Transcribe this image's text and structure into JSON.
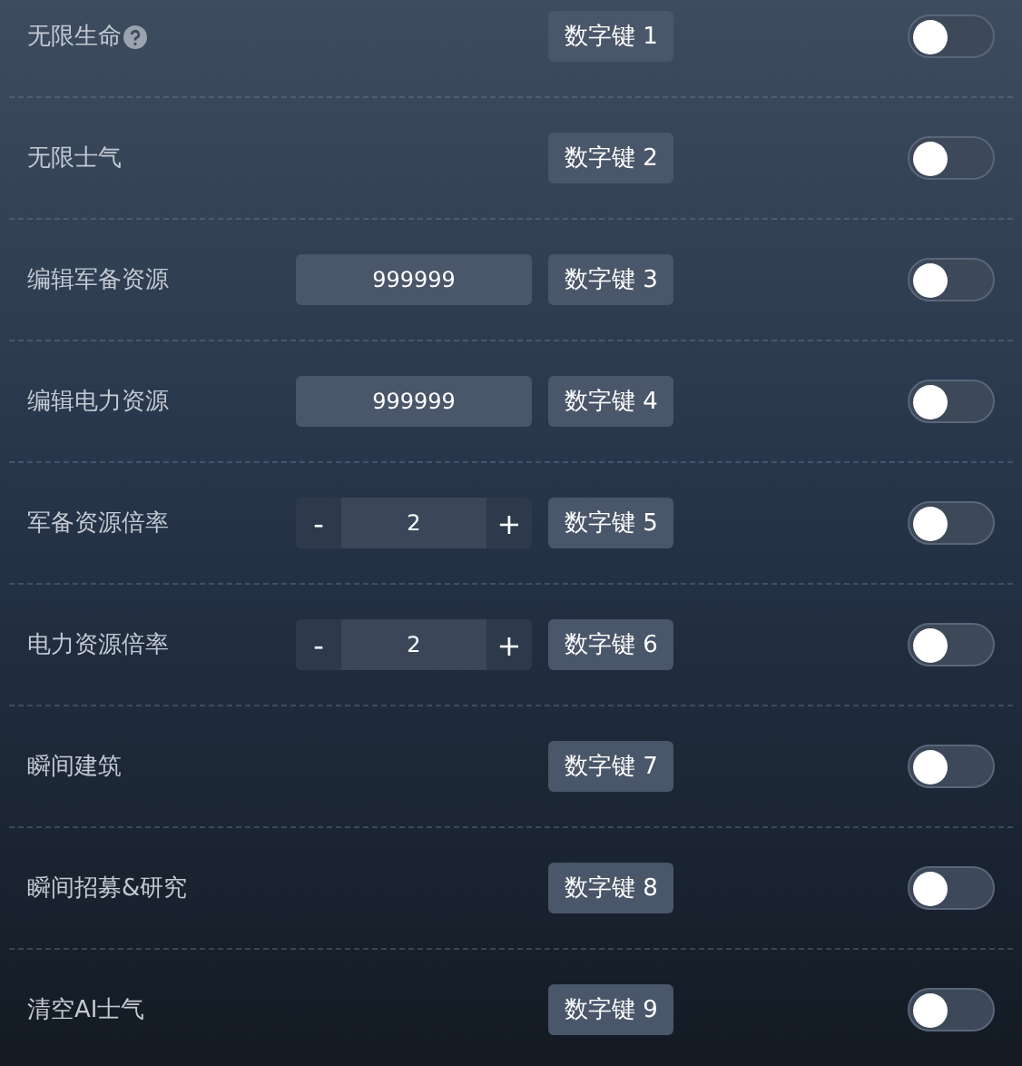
{
  "rows": [
    {
      "kind": "plain",
      "label": "无限生命",
      "help": true,
      "hotkey": "数字键 1",
      "on": false
    },
    {
      "kind": "plain",
      "label": "无限士气",
      "hotkey": "数字键 2",
      "on": false
    },
    {
      "kind": "input",
      "label": "编辑军备资源",
      "value": "999999",
      "hotkey": "数字键 3",
      "on": false
    },
    {
      "kind": "input",
      "label": "编辑电力资源",
      "value": "999999",
      "hotkey": "数字键 4",
      "on": false
    },
    {
      "kind": "stepper",
      "label": "军备资源倍率",
      "minus": "-",
      "value": "2",
      "plus": "+",
      "hotkey": "数字键 5",
      "on": false
    },
    {
      "kind": "stepper",
      "label": "电力资源倍率",
      "minus": "-",
      "value": "2",
      "plus": "+",
      "hotkey": "数字键 6",
      "on": false
    },
    {
      "kind": "plain",
      "label": "瞬间建筑",
      "hotkey": "数字键 7",
      "on": false
    },
    {
      "kind": "plain",
      "label": "瞬间招募&研究",
      "hotkey": "数字键 8",
      "on": false
    },
    {
      "kind": "plain",
      "label": "清空AI士气",
      "hotkey": "数字键 9",
      "on": false
    }
  ]
}
